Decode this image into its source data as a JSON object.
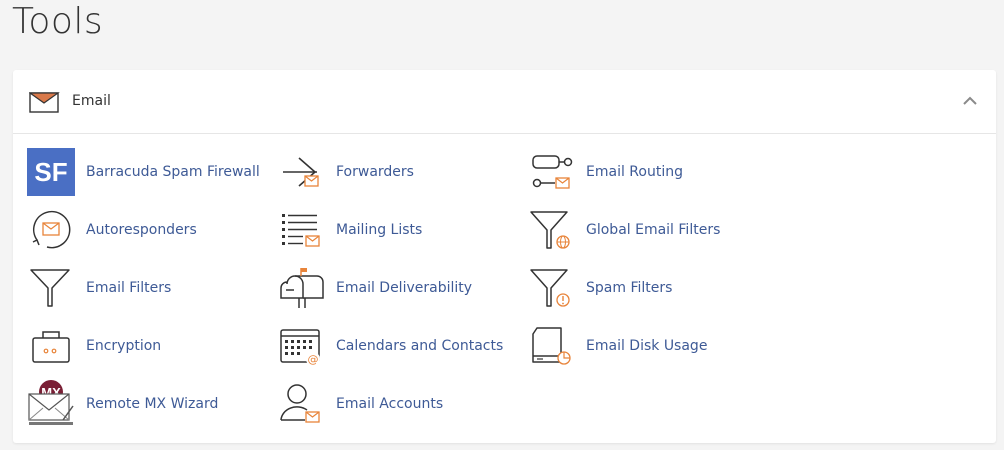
{
  "page": {
    "title": "Tools"
  },
  "section": {
    "title": "Email"
  },
  "tools": [
    {
      "label": "Barracuda Spam Firewall",
      "icon": "barracuda-sf-icon"
    },
    {
      "label": "Forwarders",
      "icon": "forwarders-icon"
    },
    {
      "label": "Email Routing",
      "icon": "email-routing-icon"
    },
    {
      "label": "Autoresponders",
      "icon": "autoresponders-icon"
    },
    {
      "label": "Mailing Lists",
      "icon": "mailing-lists-icon"
    },
    {
      "label": "Global Email Filters",
      "icon": "global-filter-icon"
    },
    {
      "label": "Email Filters",
      "icon": "email-filter-icon"
    },
    {
      "label": "Email Deliverability",
      "icon": "mailbox-icon"
    },
    {
      "label": "Spam Filters",
      "icon": "spam-filter-icon"
    },
    {
      "label": "Encryption",
      "icon": "encryption-icon"
    },
    {
      "label": "Calendars and Contacts",
      "icon": "calendar-contacts-icon"
    },
    {
      "label": "Email Disk Usage",
      "icon": "disk-usage-icon"
    },
    {
      "label": "Remote MX Wizard",
      "icon": "remote-mx-icon"
    },
    {
      "label": "Email Accounts",
      "icon": "email-accounts-icon"
    }
  ],
  "badges": {
    "sf": "SF",
    "mx": "MX"
  },
  "colors": {
    "link": "#3e5a96",
    "accent": "#e8843a",
    "sf_bg": "#4a6fc4",
    "mx_bg": "#7a1f35"
  }
}
